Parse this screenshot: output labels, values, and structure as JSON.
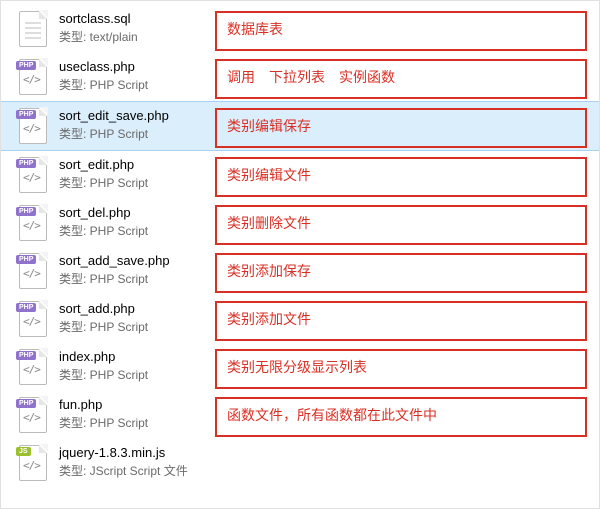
{
  "type_label_prefix": "类型: ",
  "files": [
    {
      "name": "sortclass.sql",
      "type": "text/plain",
      "icon": "plain",
      "selected": false,
      "annotation": "数据库表"
    },
    {
      "name": "useclass.php",
      "type": "PHP Script",
      "icon": "php",
      "selected": false,
      "annotation": "调用　下拉列表　实例函数"
    },
    {
      "name": "sort_edit_save.php",
      "type": "PHP Script",
      "icon": "php",
      "selected": true,
      "annotation": "类别编辑保存"
    },
    {
      "name": "sort_edit.php",
      "type": "PHP Script",
      "icon": "php",
      "selected": false,
      "annotation": "类别编辑文件"
    },
    {
      "name": "sort_del.php",
      "type": "PHP Script",
      "icon": "php",
      "selected": false,
      "annotation": "类别删除文件"
    },
    {
      "name": "sort_add_save.php",
      "type": "PHP Script",
      "icon": "php",
      "selected": false,
      "annotation": "类别添加保存"
    },
    {
      "name": "sort_add.php",
      "type": "PHP Script",
      "icon": "php",
      "selected": false,
      "annotation": "类别添加文件"
    },
    {
      "name": "index.php",
      "type": "PHP Script",
      "icon": "php",
      "selected": false,
      "annotation": "类别无限分级显示列表"
    },
    {
      "name": "fun.php",
      "type": "PHP Script",
      "icon": "php",
      "selected": false,
      "annotation": "函数文件，所有函数都在此文件中"
    },
    {
      "name": "jquery-1.8.3.min.js",
      "type": "JScript Script 文件",
      "icon": "js",
      "selected": false,
      "annotation": null
    }
  ]
}
